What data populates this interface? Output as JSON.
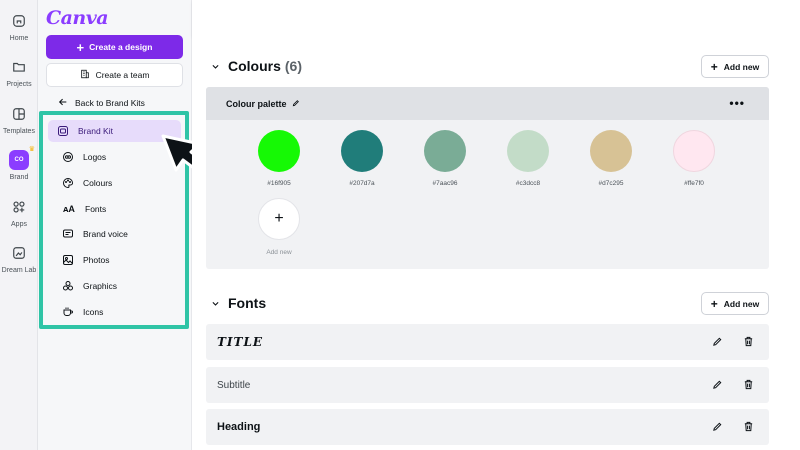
{
  "app": {
    "logo": "Canva"
  },
  "rail": {
    "items": [
      {
        "label": "Home",
        "icon": "home-icon"
      },
      {
        "label": "Projects",
        "icon": "folder-icon"
      },
      {
        "label": "Templates",
        "icon": "templates-icon"
      },
      {
        "label": "Brand",
        "icon": "brand-icon",
        "badge": "CO"
      },
      {
        "label": "Apps",
        "icon": "apps-icon"
      },
      {
        "label": "Dream Lab",
        "icon": "dream-lab-icon"
      }
    ]
  },
  "panel": {
    "create_design": "Create a design",
    "create_team": "Create a team",
    "back": "Back to Brand Kits",
    "nav": [
      {
        "label": "Brand Kit",
        "icon": "brand-kit-icon",
        "active": true
      },
      {
        "label": "Logos",
        "icon": "logos-icon"
      },
      {
        "label": "Colours",
        "icon": "palette-icon"
      },
      {
        "label": "Fonts",
        "icon": "fonts-icon"
      },
      {
        "label": "Brand voice",
        "icon": "brand-voice-icon"
      },
      {
        "label": "Photos",
        "icon": "photos-icon"
      },
      {
        "label": "Graphics",
        "icon": "graphics-icon"
      },
      {
        "label": "Icons",
        "icon": "icons-icon"
      }
    ]
  },
  "colours": {
    "title": "Colours",
    "count": "(6)",
    "add_new": "Add new",
    "palette_name": "Colour palette",
    "swatches": [
      {
        "hex": "#16f905",
        "label": "#16f905"
      },
      {
        "hex": "#207d7a",
        "label": "#207d7a"
      },
      {
        "hex": "#7aac96",
        "label": "#7aac96"
      },
      {
        "hex": "#c3dcc8",
        "label": "#c3dcc8"
      },
      {
        "hex": "#d7c295",
        "label": "#d7c295"
      },
      {
        "hex": "#ffe7f0",
        "label": "#ffe7f0"
      }
    ],
    "add_swatch_label": "Add new"
  },
  "fonts": {
    "title": "Fonts",
    "add_new": "Add new",
    "rows": [
      {
        "label": "TITLE"
      },
      {
        "label": "Subtitle"
      },
      {
        "label": "Heading"
      }
    ]
  },
  "colors": {
    "accent": "#7d2ae8",
    "highlight": "#2fc4a6"
  }
}
